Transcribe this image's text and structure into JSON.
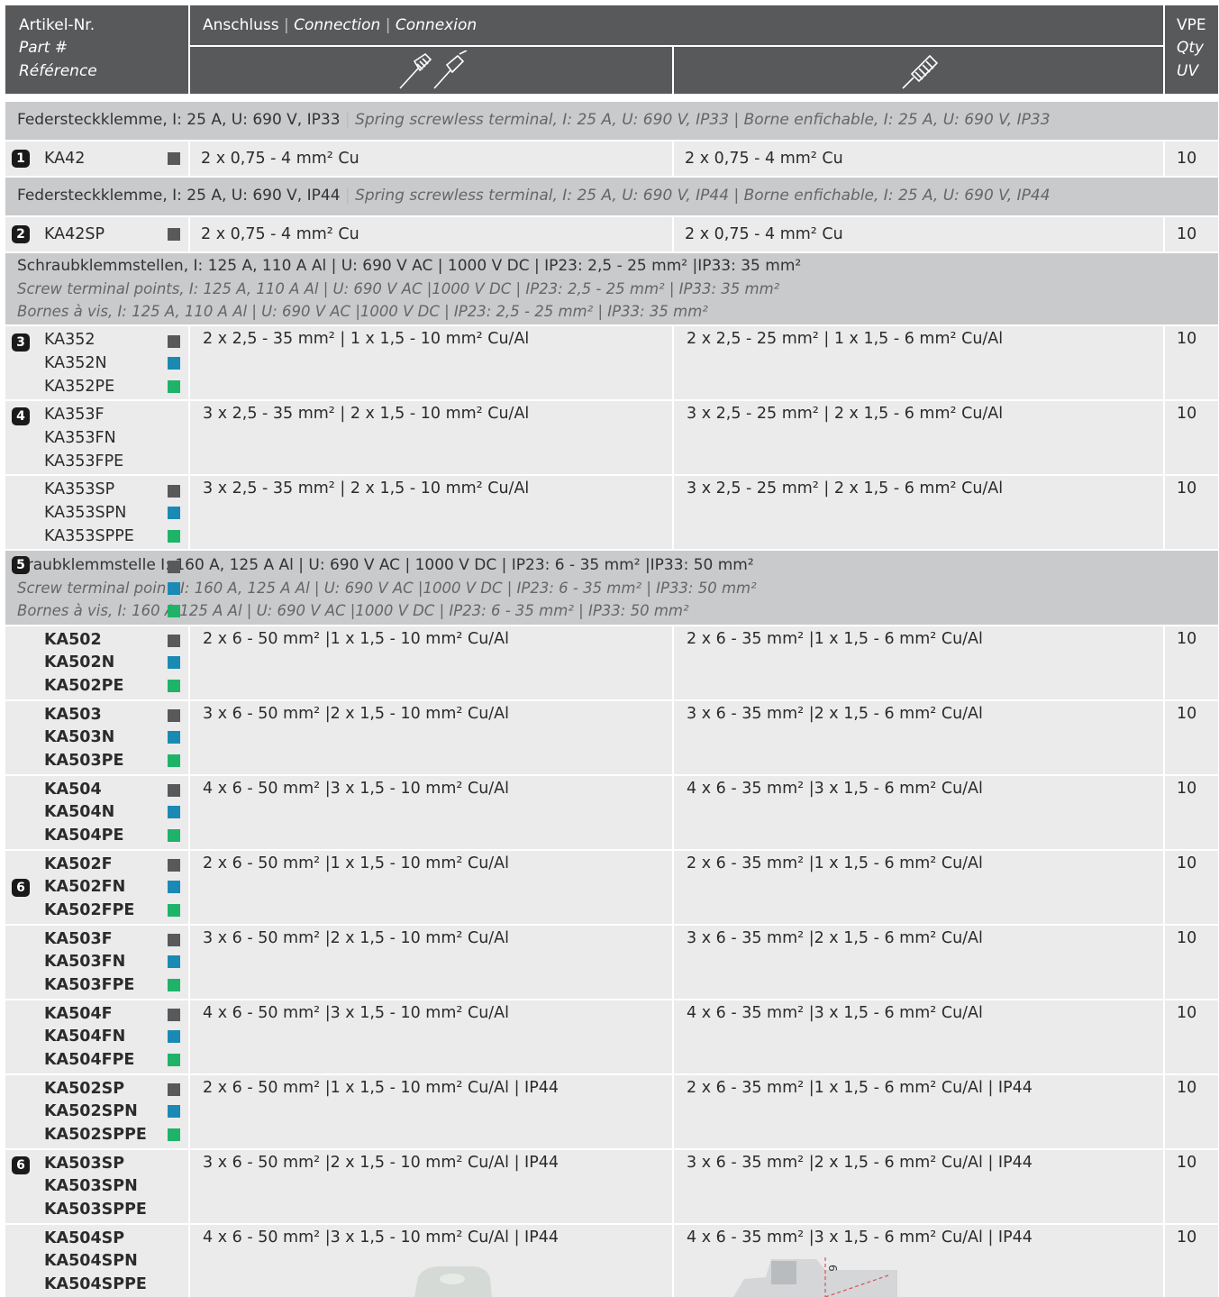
{
  "header": {
    "col_part_de": "Artikel-Nr.",
    "col_part_en": "Part #",
    "col_part_fr": "Référence",
    "conn_de": "Anschluss",
    "conn_en": "Connection",
    "conn_fr": "Connexion",
    "sep": "|",
    "qty_de": "VPE",
    "qty_en": "Qty",
    "qty_fr": "UV"
  },
  "bands": [
    {
      "de": "Federsteckklemme, I: 25 A, U: 690 V, IP33",
      "en_fr": "Spring screwless terminal, I: 25 A, U: 690 V, IP33 | Borne enfichable, I: 25 A, U: 690 V, IP33"
    },
    {
      "de": "Federsteckklemme, I: 25 A, U: 690 V, IP44",
      "en_fr": "Spring screwless terminal, I: 25 A, U: 690 V, IP44 | Borne enfichable, I: 25 A, U: 690 V, IP44"
    },
    {
      "de": "Schraubklemmstellen, I: 125 A, 110 A Al | U: 690 V AC | 1000 V DC | IP23: 2,5 - 25 mm² |IP33: 35 mm²",
      "en": "Screw terminal points, I: 125 A, 110 A Al | U: 690 V AC |1000 V DC | IP23: 2,5 - 25 mm² | IP33: 35 mm²",
      "fr": "Bornes à vis, I: 125 A, 110 A Al | U: 690 V AC |1000 V DC | IP23: 2,5 - 25 mm² | IP33: 35 mm²"
    },
    {
      "de": "hraubklemmstelle   I: 160 A, 125 A Al | U: 690 V AC | 1000 V DC | IP23: 6 - 35 mm² |IP33: 50 mm²",
      "en": "Screw terminal poin   , I: 160 A, 125 A Al | U: 690 V AC |1000 V DC | IP23: 6 - 35 mm² | IP33: 50 mm²",
      "fr": "Bornes à vis, I: 160 A  125 A Al | U: 690 V AC |1000 V DC | IP23: 6 - 35 mm² | IP33: 50 mm²"
    }
  ],
  "rows": [
    {
      "num": "1",
      "parts": [
        "KA42"
      ],
      "conn1": "2 x 0,75 - 4 mm² Cu",
      "conn2": "2 x 0,75 - 4 mm² Cu",
      "qty": "10"
    },
    {
      "num": "2",
      "parts": [
        "KA42SP"
      ],
      "conn1": "2 x 0,75 - 4 mm² Cu",
      "conn2": "2 x 0,75 - 4 mm² Cu",
      "qty": "10"
    },
    {
      "num": "3",
      "parts": [
        "KA352",
        "KA352N",
        "KA352PE"
      ],
      "conn1": "2 x 2,5 - 35 mm² | 1 x 1,5 - 10 mm² Cu/Al",
      "conn2": "2 x 2,5 - 25 mm² | 1 x 1,5 - 6 mm² Cu/Al",
      "qty": "10"
    },
    {
      "num": "4",
      "parts": [
        "KA353F",
        "KA353FN",
        "KA353FPE"
      ],
      "conn1": "3 x 2,5 - 35 mm² | 2 x 1,5 - 10 mm² Cu/Al",
      "conn2": "3 x 2,5 - 25 mm² | 2 x 1,5 - 6 mm² Cu/Al",
      "qty": "10"
    },
    {
      "num": "",
      "parts": [
        "KA353SP",
        "KA353SPN",
        "KA353SPPE"
      ],
      "conn1": "3 x 2,5 - 35 mm² | 2 x 1,5 - 10 mm² Cu/Al",
      "conn2": "3 x 2,5 - 25 mm² | 2 x 1,5 - 6 mm² Cu/Al",
      "qty": "10"
    },
    {
      "num": "5",
      "parts": [],
      "conn1": "",
      "conn2": "",
      "qty": ""
    },
    {
      "num": "",
      "parts": [
        "KA502",
        "KA502N",
        "KA502PE"
      ],
      "conn1": "2 x 6 - 50 mm² |1 x 1,5 - 10 mm² Cu/Al",
      "conn2": "2 x 6 - 35 mm² |1 x 1,5 - 6 mm² Cu/Al",
      "qty": "10"
    },
    {
      "num": "",
      "parts": [
        "KA503",
        "KA503N",
        "KA503PE"
      ],
      "conn1": "3 x 6 - 50 mm² |2 x 1,5 - 10 mm² Cu/Al",
      "conn2": "3 x 6 - 35 mm² |2 x 1,5 - 6 mm² Cu/Al",
      "qty": "10"
    },
    {
      "num": "",
      "parts": [
        "KA504",
        "KA504N",
        "KA504PE"
      ],
      "conn1": "4 x 6 - 50 mm² |3 x 1,5 - 10 mm² Cu/Al",
      "conn2": "4 x 6 - 35 mm² |3 x 1,5 - 6 mm² Cu/Al",
      "qty": "10"
    },
    {
      "num": "6",
      "parts": [
        "KA502F",
        "KA502FN",
        "KA502FPE"
      ],
      "conn1": "2 x 6 - 50 mm² |1 x 1,5 - 10 mm² Cu/Al",
      "conn2": "2 x 6 - 35 mm² |1 x 1,5 - 6 mm² Cu/Al",
      "qty": "10"
    },
    {
      "num": "",
      "parts": [
        "KA503F",
        "KA503FN",
        "KA503FPE"
      ],
      "conn1": "3 x 6 - 50 mm² |2 x 1,5 - 10 mm² Cu/Al",
      "conn2": "3 x 6 - 35 mm² |2 x 1,5 - 6 mm² Cu/Al",
      "qty": "10"
    },
    {
      "num": "",
      "parts": [
        "KA504F",
        "KA504FN",
        "KA504FPE"
      ],
      "conn1": "4 x 6 - 50 mm² |3 x 1,5 - 10 mm² Cu/Al",
      "conn2": "4 x 6 - 35 mm² |3 x 1,5 - 6 mm² Cu/Al",
      "qty": "10"
    },
    {
      "num": "",
      "parts": [
        "KA502SP",
        "KA502SPN",
        "KA502SPPE"
      ],
      "conn1": "2 x 6 - 50 mm² |1 x 1,5 - 10 mm² Cu/Al | IP44",
      "conn2": "2 x 6 - 35 mm² |1 x 1,5 - 6 mm² Cu/Al | IP44",
      "qty": "10"
    },
    {
      "num": "6",
      "parts": [
        "KA503SP",
        "KA503SPN",
        "KA503SPPE"
      ],
      "conn1": "3 x 6 - 50 mm² |2 x 1,5 - 10 mm² Cu/Al | IP44",
      "conn2": "3 x 6 - 35 mm² |2 x 1,5 - 6 mm² Cu/Al | IP44",
      "qty": "10"
    },
    {
      "num": "",
      "parts": [
        "KA504SP",
        "KA504SPN",
        "KA504SPPE"
      ],
      "conn1": "4 x 6 - 50 mm² |3 x 1,5 - 10 mm² Cu/Al | IP44",
      "conn2": "4 x 6 - 35 mm² |3 x 1,5 - 6 mm² Cu/Al | IP44",
      "qty": "10"
    }
  ],
  "drawing": {
    "dimension_label": "6"
  },
  "colors": {
    "header": "#58595b",
    "band": "#c9cacc",
    "row": "#ebebeb",
    "square_grey": "#58595b",
    "square_blue": "#1a8ab4",
    "square_green": "#1fb36a"
  }
}
